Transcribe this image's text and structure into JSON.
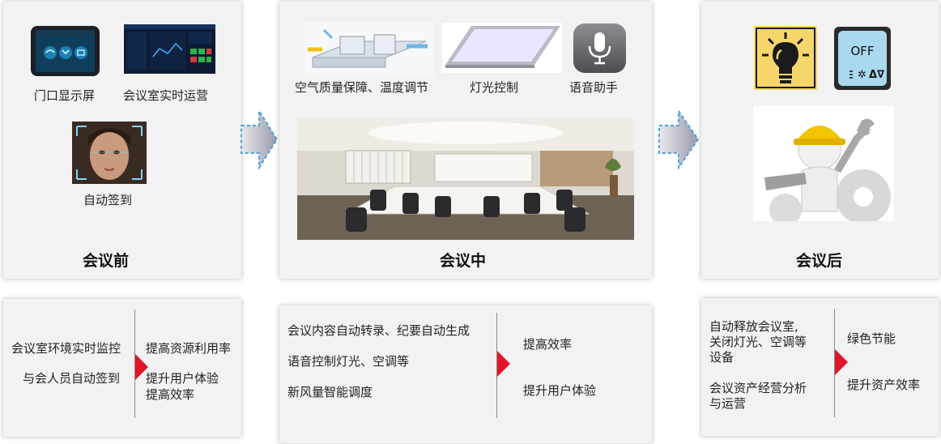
{
  "colors": {
    "accent_red": "#e0162b",
    "arrow_blue": "#4aa3df",
    "panel_bg": "#f2f2f2"
  },
  "before": {
    "items": [
      "门口显示屏",
      "会议室实时运营",
      "自动签到"
    ],
    "title": "会议前",
    "icons": [
      "tablet-screen-icon",
      "dashboard-screen-icon",
      "face-recognition-icon"
    ]
  },
  "during": {
    "items": [
      "空气质量保障、温度调节",
      "灯光控制",
      "语音助手"
    ],
    "title": "会议中",
    "icons": [
      "hvac-diagram-icon",
      "ceiling-light-icon",
      "microphone-icon",
      "meeting-room-photo"
    ]
  },
  "after": {
    "title": "会议后",
    "off_text": "OFF",
    "icons": [
      "lightbulb-icon",
      "off-switch-icon",
      "worker-wrench-icon"
    ]
  },
  "bottom": {
    "before": {
      "left": [
        "会议室环境实时监控",
        "与会人员自动签到"
      ],
      "right": [
        "提高资源利用率",
        "提升用户体验",
        "提高效率"
      ]
    },
    "during": {
      "left": [
        "会议内容自动转录、纪要自动生成",
        "语音控制灯光、空调等",
        "新风量智能调度"
      ],
      "right": [
        "提高效率",
        "提升用户体验"
      ]
    },
    "after": {
      "left": [
        "自动释放会议室,",
        "关闭灯光、空调等",
        "设备",
        "会议资产经营分析",
        "与运营"
      ],
      "right": [
        "绿色节能",
        "提升资产效率"
      ]
    }
  }
}
